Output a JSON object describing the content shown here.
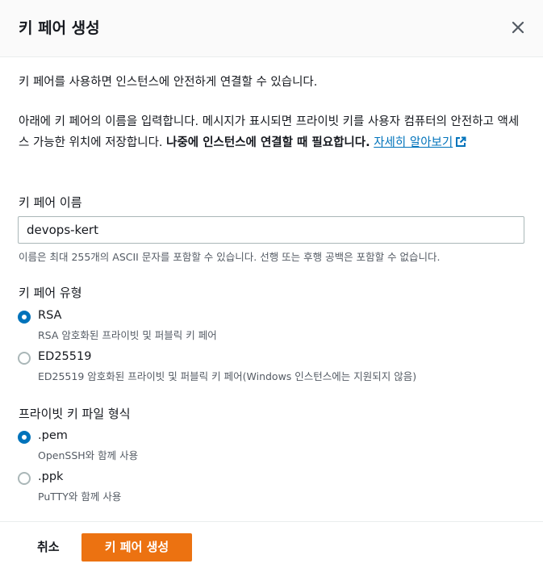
{
  "modal": {
    "title": "키 페어 생성",
    "intro": "키 페어를 사용하면 인스턴스에 안전하게 연결할 수 있습니다.",
    "description_normal": "아래에 키 페어의 이름을 입력합니다. 메시지가 표시되면 프라이빗 키를 사용자 컴퓨터의 안전하고 액세스 가능한 위치에 저장합니다. ",
    "description_bold": "나중에 인스턴스에 연결할 때 필요합니다.",
    "learn_more_link": "자세히 알아보기"
  },
  "key_name": {
    "label": "키 페어 이름",
    "value": "devops-kert",
    "hint": "이름은 최대 255개의 ASCII 문자를 포함할 수 있습니다. 선행 또는 후행 공백은 포함할 수 없습니다."
  },
  "key_type": {
    "label": "키 페어 유형",
    "options": [
      {
        "label": "RSA",
        "description": "RSA 암호화된 프라이빗 및 퍼블릭 키 페어",
        "selected": true
      },
      {
        "label": "ED25519",
        "description": "ED25519 암호화된 프라이빗 및 퍼블릭 키 페어(Windows 인스턴스에는 지원되지 않음)",
        "selected": false
      }
    ]
  },
  "file_format": {
    "label": "프라이빗 키 파일 형식",
    "options": [
      {
        "label": ".pem",
        "description": "OpenSSH와 함께 사용",
        "selected": true
      },
      {
        "label": ".ppk",
        "description": "PuTTY와 함께 사용",
        "selected": false
      }
    ]
  },
  "footer": {
    "cancel_label": "취소",
    "create_label": "키 페어 생성"
  },
  "colors": {
    "accent": "#0073bb",
    "primary_button": "#ec7211"
  },
  "icons": {
    "close": "close-icon",
    "external_link": "external-link-icon"
  }
}
